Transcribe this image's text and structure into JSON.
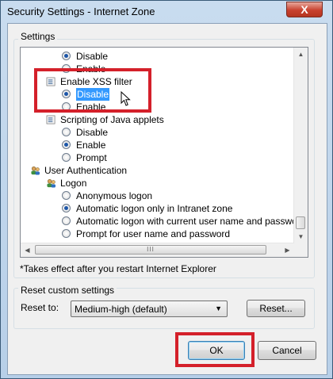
{
  "window": {
    "title": "Security Settings - Internet Zone",
    "close_glyph": "X"
  },
  "settings_group": {
    "label": "Settings"
  },
  "list": {
    "rows": [
      {
        "kind": "radio",
        "label": "Disable",
        "checked": true,
        "name": "radio-disable-1"
      },
      {
        "kind": "radio",
        "label": "Enable",
        "checked": false,
        "name": "radio-enable-1"
      },
      {
        "kind": "header",
        "label": "Enable XSS filter",
        "icon": "setting-icon",
        "name": "header-enable-xss-filter"
      },
      {
        "kind": "radio",
        "label": "Disable",
        "checked": true,
        "selected": true,
        "name": "radio-xss-disable"
      },
      {
        "kind": "radio",
        "label": "Enable",
        "checked": false,
        "name": "radio-xss-enable"
      },
      {
        "kind": "header",
        "label": "Scripting of Java applets",
        "icon": "setting-icon",
        "name": "header-scripting-java-applets"
      },
      {
        "kind": "radio",
        "label": "Disable",
        "checked": false,
        "name": "radio-java-disable"
      },
      {
        "kind": "radio",
        "label": "Enable",
        "checked": true,
        "name": "radio-java-enable"
      },
      {
        "kind": "radio",
        "label": "Prompt",
        "checked": false,
        "name": "radio-java-prompt"
      },
      {
        "kind": "category",
        "label": "User Authentication",
        "icon": "users-icon",
        "name": "category-user-authentication"
      },
      {
        "kind": "subcategory",
        "label": "Logon",
        "icon": "users-icon",
        "name": "subcategory-logon"
      },
      {
        "kind": "radio",
        "label": "Anonymous logon",
        "checked": false,
        "name": "radio-anonymous-logon"
      },
      {
        "kind": "radio",
        "label": "Automatic logon only in Intranet zone",
        "checked": true,
        "name": "radio-auto-logon-intranet"
      },
      {
        "kind": "radio",
        "label": "Automatic logon with current user name and password",
        "checked": false,
        "name": "radio-auto-logon-current-user"
      },
      {
        "kind": "radio",
        "label": "Prompt for user name and password",
        "checked": false,
        "name": "radio-prompt-credentials"
      }
    ],
    "hscroll_grip": "III"
  },
  "note": "*Takes effect after you restart Internet Explorer",
  "reset_group": {
    "label": "Reset custom settings",
    "reset_to_label": "Reset to:",
    "dropdown_value": "Medium-high (default)",
    "reset_button": "Reset..."
  },
  "footer": {
    "ok": "OK",
    "cancel": "Cancel"
  },
  "colors": {
    "highlight": "#d4202a",
    "selection": "#3399ff",
    "radio_dot": "#1d56a8"
  }
}
